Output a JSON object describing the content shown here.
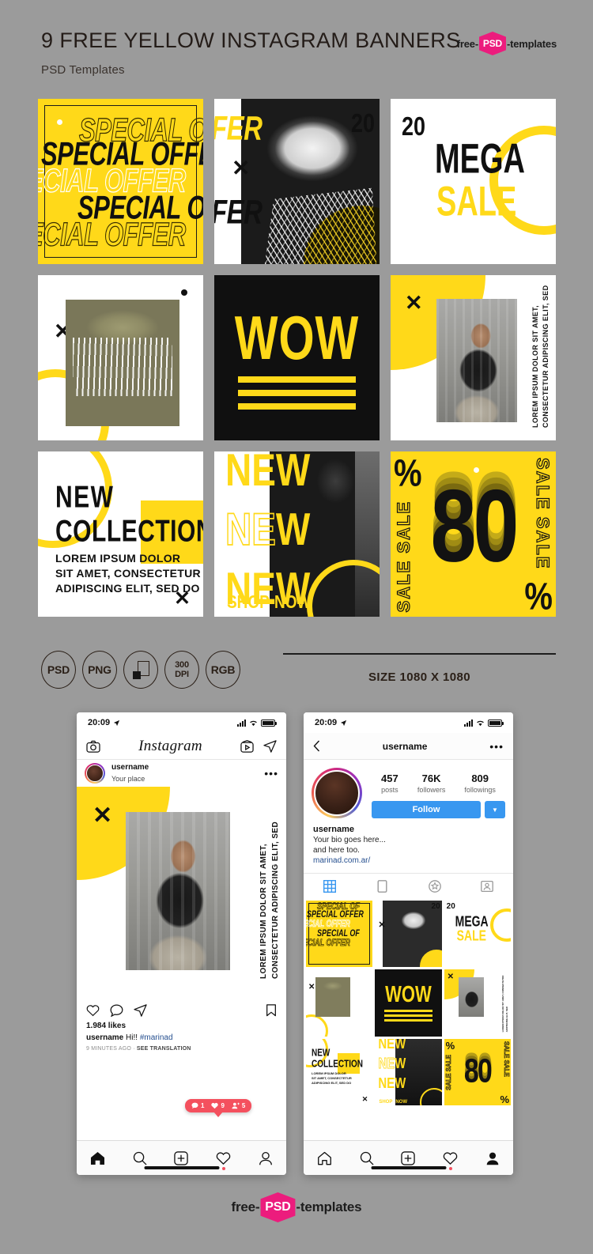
{
  "header": {
    "title": "9 FREE YELLOW INSTAGRAM BANNERS",
    "subtitle": "PSD Templates",
    "brand_left": "free-",
    "brand_mid": "PSD",
    "brand_right": "-templates"
  },
  "colors": {
    "yellow": "#ffd919",
    "black": "#101010",
    "background": "#9b9b9b",
    "brand_pink": "#ec1c7d",
    "ig_blue": "#3897f0",
    "notif_red": "#f4505e"
  },
  "banners": [
    {
      "id": "special-offer",
      "lines": [
        "SPECIAL OF",
        "SPECIAL OFFER",
        "ECIAL OFFER",
        "SPECIAL OF",
        "ECIAL OFFER"
      ]
    },
    {
      "id": "hat-model",
      "text_top": "FER",
      "text_bottom": "FER",
      "number": "20",
      "mark": "✕"
    },
    {
      "id": "mega-sale",
      "number": "20",
      "line1": "MEGA",
      "line2": "SALE"
    },
    {
      "id": "bucket-hat",
      "mark": "✕"
    },
    {
      "id": "wow",
      "word": "WOW",
      "bars": 3
    },
    {
      "id": "seated-model",
      "mark": "✕",
      "vertical_text": "LOREM IPSUM DOLOR SIT AMET,\nCONSECTETUR ADIPISCING ELIT, SED"
    },
    {
      "id": "new-collection",
      "line1": "NEW",
      "line2": "COLLECTION",
      "body": "LOREM IPSUM DOLOR\nSIT AMET, CONSECTETUR\nADIPISCING ELIT, SED DO",
      "mark": "✕"
    },
    {
      "id": "new-new-new",
      "col_left": [
        "NE",
        "NE",
        "NE"
      ],
      "col_right": [
        "W",
        "W",
        "W"
      ],
      "cta_1": "SHOP",
      "cta_2": "NOW"
    },
    {
      "id": "eighty-percent",
      "number": "80",
      "percent_tl": "%",
      "percent_br": "%",
      "side_text": "SALE SALE"
    }
  ],
  "formats": {
    "badges": [
      "PSD",
      "PNG",
      "layers-icon",
      "300\nDPI",
      "RGB"
    ],
    "psd": "PSD",
    "png": "PNG",
    "dpi_top": "300",
    "dpi_bottom": "DPI",
    "rgb": "RGB",
    "size_label": "SIZE 1080 X 1080"
  },
  "phone_feed": {
    "status": {
      "time": "20:09",
      "location_icon": "location-arrow-icon"
    },
    "topbar": {
      "camera_icon": "camera-icon",
      "logo": "Instagram",
      "igtv_icon": "igtv-icon",
      "send_icon": "send-icon"
    },
    "post_header": {
      "username": "username",
      "place": "Your place",
      "more_icon": "more-options-icon"
    },
    "post": {
      "mark": "✕",
      "vertical_text": "LOREM IPSUM DOLOR SIT AMET,\nCONSECTETUR ADIPISCING ELIT, SED"
    },
    "actions": {
      "like_icon": "heart-icon",
      "comment_icon": "comment-icon",
      "share_icon": "send-icon",
      "save_icon": "bookmark-icon"
    },
    "meta": {
      "likes": "1.984 likes",
      "caption_user": "username",
      "caption_text": " Hi!! ",
      "caption_tag": "#marinad",
      "time_ago": "9 MINUTES AGO",
      "separator": "·",
      "translate": "SEE TRANSLATION"
    },
    "notifications": [
      {
        "icon": "comment-icon",
        "count": "1"
      },
      {
        "icon": "heart-icon",
        "count": "9"
      },
      {
        "icon": "person-add-icon",
        "count": "5"
      }
    ],
    "tabbar": [
      "home-icon",
      "search-icon",
      "add-post-icon",
      "activity-icon",
      "profile-icon"
    ]
  },
  "phone_profile": {
    "status": {
      "time": "20:09",
      "location_icon": "location-arrow-icon"
    },
    "navbar": {
      "back_icon": "back-chevron-icon",
      "title": "username",
      "more_icon": "more-options-icon"
    },
    "stats": [
      {
        "number": "457",
        "label": "posts"
      },
      {
        "number": "76K",
        "label": "followers"
      },
      {
        "number": "809",
        "label": "followings"
      }
    ],
    "follow_button": "Follow",
    "caret": "▼",
    "bio": {
      "username": "username",
      "line1": "Your bio goes here...",
      "line2": "and here too.",
      "url": "marinad.com.ar/"
    },
    "tabs": [
      "grid-icon",
      "reels-icon",
      "guides-icon",
      "tagged-icon"
    ],
    "tabbar": [
      "home-icon",
      "search-icon",
      "add-post-icon",
      "activity-icon",
      "profile-icon"
    ]
  }
}
